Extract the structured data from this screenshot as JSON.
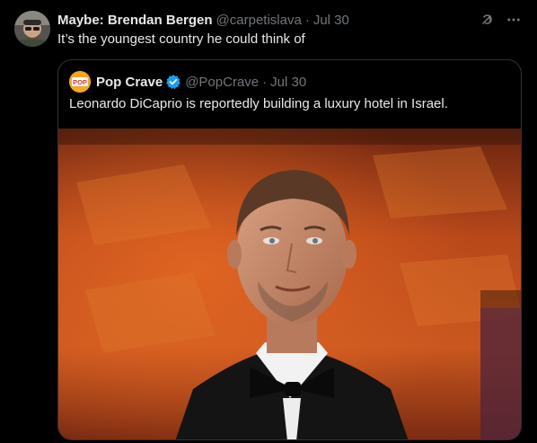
{
  "tweet": {
    "author_name": "Maybe: Brendan Bergen",
    "handle": "@carpetislava",
    "separator": "·",
    "date": "Jul 30",
    "text": "It’s the youngest country he could think of",
    "icons": [
      "grok-icon",
      "more-icon"
    ]
  },
  "quote": {
    "author_name": "Pop Crave",
    "avatar_text": "POP",
    "verified": true,
    "handle": "@PopCrave",
    "separator": "·",
    "date": "Jul 30",
    "text": "Leonardo DiCaprio is reportedly building a luxury hotel in Israel.",
    "media": "photo"
  },
  "colors": {
    "background": "#000000",
    "text": "#e7e9ea",
    "muted": "#71767b",
    "border": "#2f3336",
    "verified": "#1d9bf0",
    "pop_crave_brand": "#f5a623"
  }
}
